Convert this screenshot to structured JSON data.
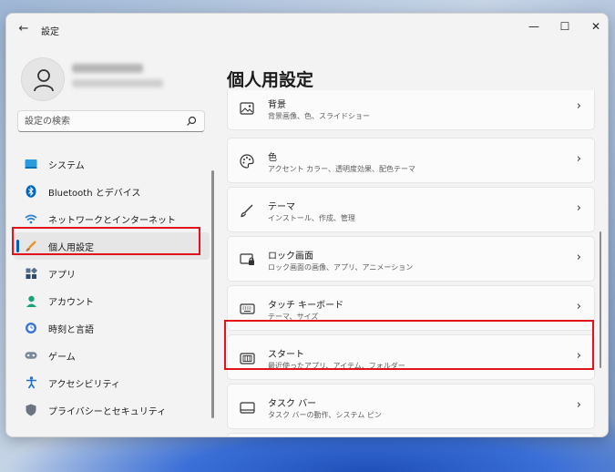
{
  "window": {
    "title": "設定"
  },
  "profile": {},
  "search": {
    "placeholder": "設定の検索"
  },
  "nav": {
    "items": [
      {
        "label": "システム"
      },
      {
        "label": "Bluetooth とデバイス"
      },
      {
        "label": "ネットワークとインターネット"
      },
      {
        "label": "個人用設定"
      },
      {
        "label": "アプリ"
      },
      {
        "label": "アカウント"
      },
      {
        "label": "時刻と言語"
      },
      {
        "label": "ゲーム"
      },
      {
        "label": "アクセシビリティ"
      },
      {
        "label": "プライバシーとセキュリティ"
      }
    ],
    "selected_index": 3
  },
  "main": {
    "title": "個人用設定",
    "cards": [
      {
        "title": "背景",
        "subtitle": "背景画像、色、スライドショー",
        "icon": "image-icon"
      },
      {
        "title": "色",
        "subtitle": "アクセント カラー、透明度効果、配色テーマ",
        "icon": "palette-icon"
      },
      {
        "title": "テーマ",
        "subtitle": "インストール、作成、管理",
        "icon": "brush-icon"
      },
      {
        "title": "ロック画面",
        "subtitle": "ロック画面の画像、アプリ、アニメーション",
        "icon": "lock-screen-icon"
      },
      {
        "title": "タッチ キーボード",
        "subtitle": "テーマ、サイズ",
        "icon": "keyboard-icon"
      },
      {
        "title": "スタート",
        "subtitle": "最近使ったアプリ、アイテム、フォルダー",
        "icon": "start-icon"
      },
      {
        "title": "タスク バー",
        "subtitle": "タスク バーの動作、システム ピン",
        "icon": "taskbar-icon"
      }
    ]
  },
  "colors": {
    "accent": "#005fb8",
    "highlight": "#e0141a"
  }
}
